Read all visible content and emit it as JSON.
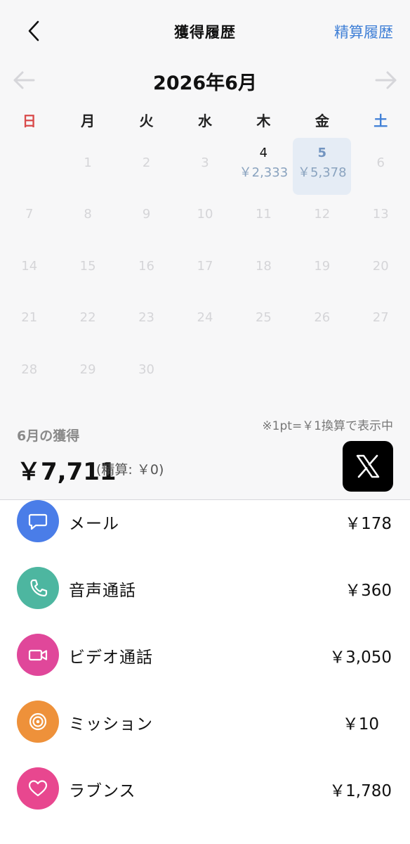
{
  "nav": {
    "title": "獲得履歴",
    "settlement_link": "精算履歴"
  },
  "calendar": {
    "month_title": "2026年6月",
    "weekdays": [
      "日",
      "月",
      "火",
      "水",
      "木",
      "金",
      "土"
    ],
    "days": [
      {
        "num": "",
        "amount": "",
        "state": "empty"
      },
      {
        "num": "1",
        "amount": "",
        "state": "inactive"
      },
      {
        "num": "2",
        "amount": "",
        "state": "inactive"
      },
      {
        "num": "3",
        "amount": "",
        "state": "inactive"
      },
      {
        "num": "4",
        "amount": "￥2,333",
        "state": "active"
      },
      {
        "num": "5",
        "amount": "￥5,378",
        "state": "selected"
      },
      {
        "num": "6",
        "amount": "",
        "state": "inactive"
      },
      {
        "num": "7",
        "amount": "",
        "state": "inactive"
      },
      {
        "num": "8",
        "amount": "",
        "state": "inactive"
      },
      {
        "num": "9",
        "amount": "",
        "state": "inactive"
      },
      {
        "num": "10",
        "amount": "",
        "state": "inactive"
      },
      {
        "num": "11",
        "amount": "",
        "state": "inactive"
      },
      {
        "num": "12",
        "amount": "",
        "state": "inactive"
      },
      {
        "num": "13",
        "amount": "",
        "state": "inactive"
      },
      {
        "num": "14",
        "amount": "",
        "state": "inactive"
      },
      {
        "num": "15",
        "amount": "",
        "state": "inactive"
      },
      {
        "num": "16",
        "amount": "",
        "state": "inactive"
      },
      {
        "num": "17",
        "amount": "",
        "state": "inactive"
      },
      {
        "num": "18",
        "amount": "",
        "state": "inactive"
      },
      {
        "num": "19",
        "amount": "",
        "state": "inactive"
      },
      {
        "num": "20",
        "amount": "",
        "state": "inactive"
      },
      {
        "num": "21",
        "amount": "",
        "state": "inactive"
      },
      {
        "num": "22",
        "amount": "",
        "state": "inactive"
      },
      {
        "num": "23",
        "amount": "",
        "state": "inactive"
      },
      {
        "num": "24",
        "amount": "",
        "state": "inactive"
      },
      {
        "num": "25",
        "amount": "",
        "state": "inactive"
      },
      {
        "num": "26",
        "amount": "",
        "state": "inactive"
      },
      {
        "num": "27",
        "amount": "",
        "state": "inactive"
      },
      {
        "num": "28",
        "amount": "",
        "state": "inactive"
      },
      {
        "num": "29",
        "amount": "",
        "state": "inactive"
      },
      {
        "num": "30",
        "amount": "",
        "state": "inactive"
      }
    ]
  },
  "summary": {
    "note": "※1pt=￥1換算で表示中",
    "label": "6月の獲得",
    "total": "￥7,711",
    "settlement": "(精算: ￥0)"
  },
  "earnings": [
    {
      "id": "mail",
      "label": "メール",
      "value": "￥178",
      "color": "#4a7de8",
      "icon": "chat-bubble-icon"
    },
    {
      "id": "voice-call",
      "label": "音声通話",
      "value": "￥360",
      "color": "#4db6a0",
      "icon": "phone-icon"
    },
    {
      "id": "video-call",
      "label": "ビデオ通話",
      "value": "￥3,050",
      "color": "#e0479a",
      "icon": "video-camera-icon"
    },
    {
      "id": "mission",
      "label": "ミッション",
      "value": "￥10",
      "color": "#ee913a",
      "icon": "target-icon"
    },
    {
      "id": "love-bounce",
      "label": "ラブンス",
      "value": "￥1,780",
      "color": "#e8478f",
      "icon": "heart-icon"
    }
  ],
  "colors": {
    "accent": "#3f7fd6",
    "sunday": "#d94b4b",
    "saturday": "#3f7fd6",
    "selected_day_bg": "#e5ecf5"
  }
}
